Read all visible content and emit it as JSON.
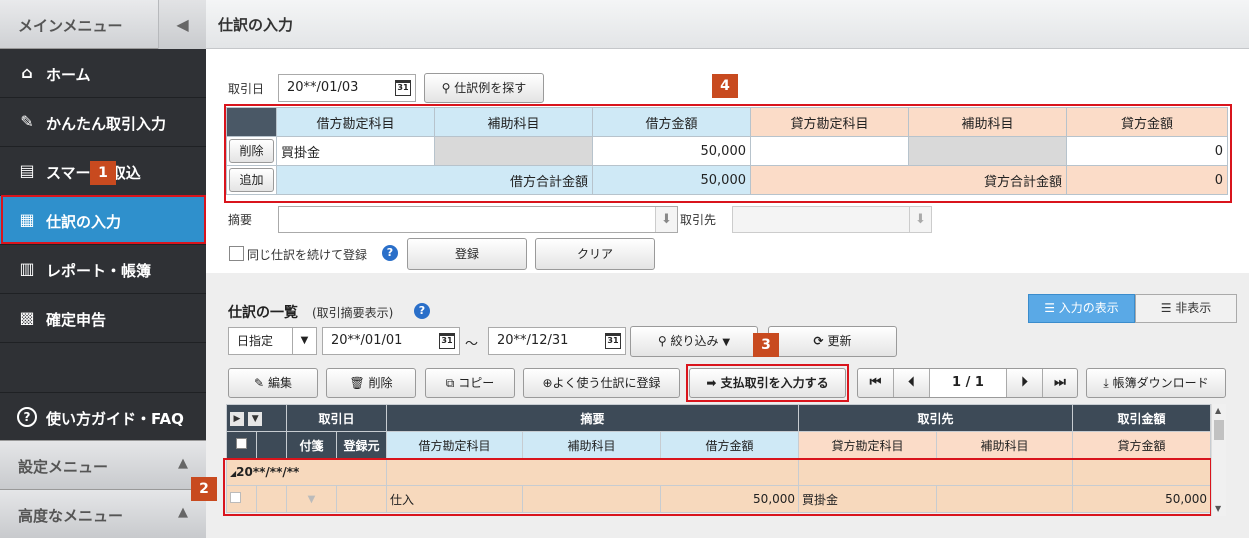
{
  "sidebar": {
    "title": "メインメニュー",
    "toggle_icon": "◀",
    "items": [
      {
        "label": "ホーム",
        "icon": "home-icon"
      },
      {
        "label": "かんたん取引入力",
        "icon": "pencil-icon"
      },
      {
        "label": "スマー  引取込",
        "icon": "import-icon"
      },
      {
        "label": "仕訳の入力",
        "icon": "journal-icon"
      },
      {
        "label": "レポート・帳簿",
        "icon": "chart-icon"
      },
      {
        "label": "確定申告",
        "icon": "calculator-icon"
      }
    ],
    "help": "使い方ガイド・FAQ",
    "settings": "設定メニュー",
    "advanced": "高度なメニュー"
  },
  "header": {
    "title": "仕訳の入力"
  },
  "entry": {
    "date_label": "取引日",
    "date_value": "20**/01/03",
    "search_example": "仕訳例を探す",
    "headers": {
      "debit_account": "借方勘定科目",
      "debit_sub": "補助科目",
      "debit_amount": "借方金額",
      "credit_account": "貸方勘定科目",
      "credit_sub": "補助科目",
      "credit_amount": "貸方金額"
    },
    "row": {
      "delete": "削除",
      "debit_account": "買掛金",
      "debit_amount": "50,000",
      "credit_amount": "0"
    },
    "totals": {
      "add": "追加",
      "debit_label": "借方合計金額",
      "debit_total": "50,000",
      "credit_label": "貸方合計金額",
      "credit_total": "0"
    },
    "memo_label": "摘要",
    "partner_label": "取引先",
    "repeat_label": "同じ仕訳を続けて登録",
    "register": "登録",
    "clear": "クリア"
  },
  "list": {
    "title": "仕訳の一覧",
    "subtitle": "(取引摘要表示)",
    "show_input": "入力の表示",
    "hide": "非表示",
    "range_type": "日指定",
    "date_from": "20**/01/01",
    "tilde": "～",
    "date_to": "20**/12/31",
    "filter": "絞り込み",
    "refresh": "更新",
    "edit": "編集",
    "delete": "削除",
    "copy": "コピー",
    "favorite": "よく使う仕訳に登録",
    "payment": "支払取引を入力する",
    "page_current": "1",
    "page_sep": "/",
    "page_total": "1",
    "download": "帳簿ダウンロード",
    "head1": {
      "date": "取引日",
      "memo": "摘要",
      "partner": "取引先",
      "amount": "取引金額"
    },
    "head2": {
      "attach": "付箋",
      "source": "登録元",
      "debit_account": "借方勘定科目",
      "debit_sub": "補助科目",
      "debit_amount": "借方金額",
      "credit_account": "貸方勘定科目",
      "credit_sub": "補助科目",
      "credit_amount": "貸方金額"
    },
    "group_date": "20**/**/**",
    "row": {
      "debit_account": "仕入",
      "debit_amount": "50,000",
      "credit_account": "買掛金",
      "credit_amount": "50,000"
    }
  },
  "badges": [
    "1",
    "2",
    "3",
    "4"
  ]
}
